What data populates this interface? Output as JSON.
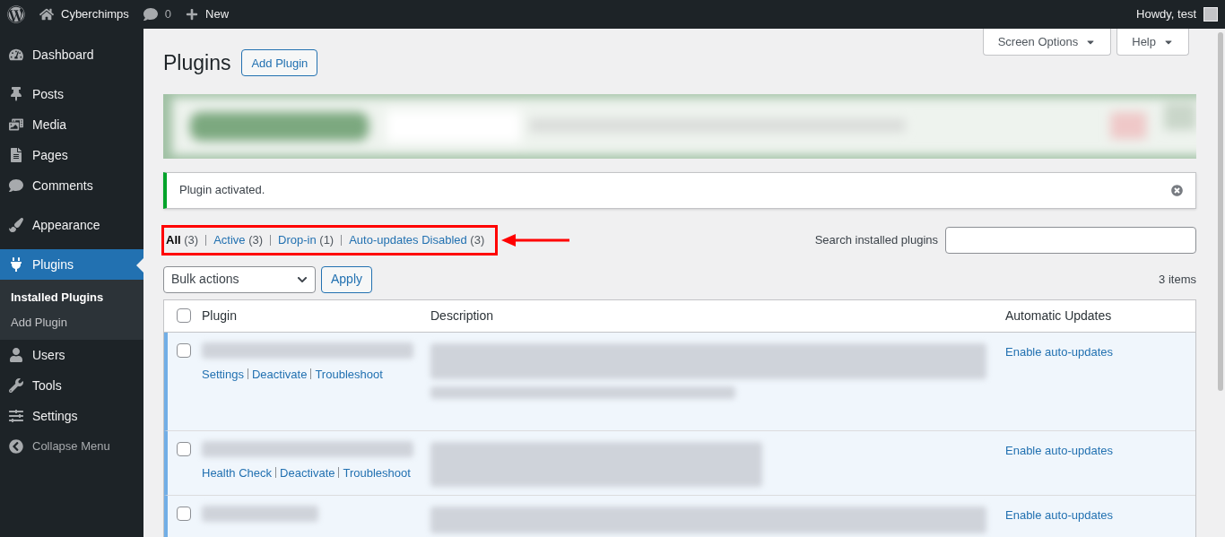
{
  "admin_bar": {
    "site": "Cyberchimps",
    "comments": "0",
    "new": "New",
    "greeting": "Howdy, test"
  },
  "sidebar": {
    "items": [
      {
        "label": "Dashboard",
        "selected": false
      },
      {
        "label": "Posts",
        "selected": false
      },
      {
        "label": "Media",
        "selected": false
      },
      {
        "label": "Pages",
        "selected": false
      },
      {
        "label": "Comments",
        "selected": false
      },
      {
        "label": "Appearance",
        "selected": false
      },
      {
        "label": "Plugins",
        "selected": true,
        "children": [
          {
            "label": "Installed Plugins",
            "selected": true
          },
          {
            "label": "Add Plugin",
            "selected": false
          }
        ]
      },
      {
        "label": "Users",
        "selected": false
      },
      {
        "label": "Tools",
        "selected": false
      },
      {
        "label": "Settings",
        "selected": false
      },
      {
        "label": "Collapse Menu",
        "selected": false
      }
    ]
  },
  "screen_options": "Screen Options",
  "help": "Help",
  "page_title": "Plugins",
  "add_button": "Add Plugin",
  "notice": "Plugin activated.",
  "filters": [
    {
      "label": "All",
      "count": "(3)",
      "selected": true
    },
    {
      "label": "Active",
      "count": "(3)",
      "selected": false
    },
    {
      "label": "Drop-in",
      "count": "(1)",
      "selected": false
    },
    {
      "label": "Auto-updates Disabled",
      "count": "(3)",
      "selected": false
    }
  ],
  "search": {
    "label": "Search installed plugins"
  },
  "bulk": {
    "value": "Bulk actions",
    "apply": "Apply"
  },
  "items_count": "3 items",
  "table": {
    "select_all_checked": false,
    "columns": [
      "Plugin",
      "Description",
      "Automatic Updates"
    ],
    "rows": [
      {
        "active": true,
        "checked": false,
        "actions": [
          "Settings",
          "Deactivate",
          "Troubleshoot"
        ],
        "auto_update": "Enable auto-updates"
      },
      {
        "active": true,
        "checked": false,
        "actions": [
          "Health Check",
          "Deactivate",
          "Troubleshoot"
        ],
        "auto_update": "Enable auto-updates"
      },
      {
        "active": true,
        "checked": false,
        "actions": [],
        "auto_update": "Enable auto-updates"
      }
    ]
  }
}
